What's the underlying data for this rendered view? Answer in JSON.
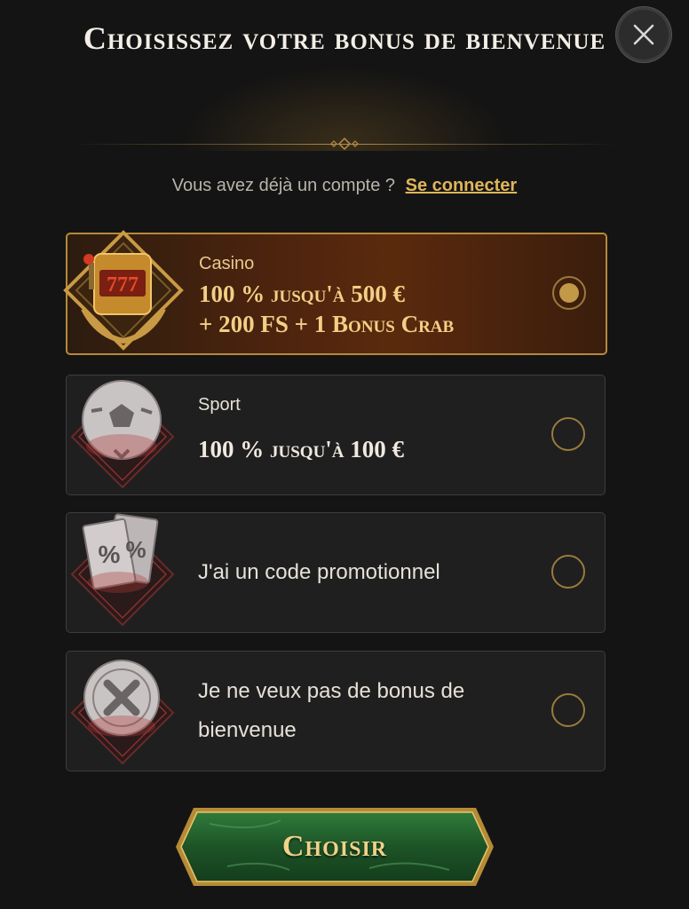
{
  "header": {
    "title": "Choisissez votre bonus de bienvenue",
    "close_icon": "close-icon"
  },
  "login": {
    "prompt": "Vous avez déjà un compte ?",
    "link": "Se connecter"
  },
  "options": [
    {
      "category": "Casino",
      "line1": "100 % jusqu'à 500 €",
      "line2": "+ 200 FS + 1 Bonus Crab",
      "icon": "slot-machine-icon",
      "selected": true
    },
    {
      "category": "Sport",
      "line1": "100 % jusqu'à 100 €",
      "icon": "soccer-ball-icon",
      "selected": false
    },
    {
      "label": "J'ai un code promotionnel",
      "icon": "promo-code-icon",
      "selected": false
    },
    {
      "label": "Je ne veux pas de bonus de bienvenue",
      "icon": "no-bonus-icon",
      "selected": false
    }
  ],
  "action": {
    "choose_label": "Choisir"
  },
  "colors": {
    "accent_gold": "#c29a47",
    "selected_bg": "#4a230e",
    "button_green": "#1f5a2a"
  }
}
